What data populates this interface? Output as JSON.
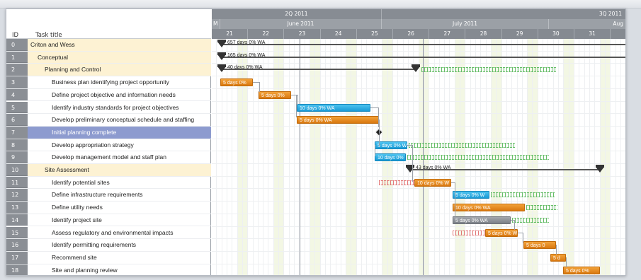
{
  "grid": {
    "id_header": "ID",
    "title_header": "Task title",
    "rows": [
      {
        "id": "0",
        "title": "Criton and Wess",
        "type": "summary"
      },
      {
        "id": "1",
        "title": "Conceptual",
        "type": "summary"
      },
      {
        "id": "2",
        "title": "Planning and Control",
        "type": "summary"
      },
      {
        "id": "3",
        "title": "Business plan identifying project opportunity",
        "type": "task"
      },
      {
        "id": "4",
        "title": "Define project objective and information needs",
        "type": "task"
      },
      {
        "id": "5",
        "title": "Identify industry standards for project objectives",
        "type": "task"
      },
      {
        "id": "6",
        "title": "Develop preliminary conceptual schedule and staffing",
        "type": "task"
      },
      {
        "id": "7",
        "title": "Initial planning complete",
        "type": "selected"
      },
      {
        "id": "8",
        "title": "Develop appropriation strategy",
        "type": "task"
      },
      {
        "id": "9",
        "title": "Develop management model and staff plan",
        "type": "task"
      },
      {
        "id": "10",
        "title": "Site Assessment",
        "type": "summary"
      },
      {
        "id": "11",
        "title": "Identify potential sites",
        "type": "task"
      },
      {
        "id": "12",
        "title": "Define infrastructure requirements",
        "type": "task"
      },
      {
        "id": "13",
        "title": "Define utility needs",
        "type": "task"
      },
      {
        "id": "14",
        "title": "Identify project site",
        "type": "task"
      },
      {
        "id": "15",
        "title": "Assess regulatory and environmental impacts",
        "type": "task"
      },
      {
        "id": "16",
        "title": "Identify permitting requirements",
        "type": "task"
      },
      {
        "id": "17",
        "title": "Recommend site",
        "type": "task"
      },
      {
        "id": "18",
        "title": "Site and planning review",
        "type": "task"
      }
    ]
  },
  "timeline": {
    "quarters": [
      "",
      "2Q 2011",
      "3Q 2011"
    ],
    "months": [
      "M",
      "June 2011",
      "July 2011",
      "Aug"
    ],
    "weeks": [
      "21",
      "22",
      "23",
      "24",
      "25",
      "26",
      "27",
      "28",
      "29",
      "30",
      "31",
      ""
    ]
  },
  "bars": [
    {
      "label": "657 days 0% WA"
    },
    {
      "label": "165 days 0% WA"
    },
    {
      "label": "40 days 0% WA"
    },
    {
      "label": "5 days 0%"
    },
    {
      "label": "5 days 0%"
    },
    {
      "label": "10 days 0% WA"
    },
    {
      "label": "5 days 0% WA"
    },
    {
      "label": ""
    },
    {
      "label": "5 days 0% W"
    },
    {
      "label": "10 days 0%"
    },
    {
      "label": "43 days 0% WA"
    },
    {
      "label": "10 days 0% W"
    },
    {
      "label": "5 days 0% W"
    },
    {
      "label": "10 days 0% WA"
    },
    {
      "label": "5 days 0% WA"
    },
    {
      "label": "5 days 0% W"
    },
    {
      "label": "5 days 0"
    },
    {
      "label": "5 d"
    },
    {
      "label": "5 days 0%"
    }
  ],
  "colors": {
    "summary_row": "#fdf2d3",
    "selected_row": "#8d9bcf",
    "task_orange": "#e88c1f",
    "task_blue": "#2aaee6",
    "weekend": "#f3f7e4"
  }
}
